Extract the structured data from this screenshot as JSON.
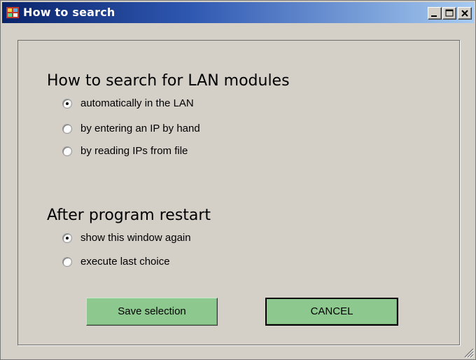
{
  "window": {
    "title": "How to search"
  },
  "search_section": {
    "heading": "How to search for LAN modules",
    "options": [
      {
        "label": "automatically in the LAN",
        "selected": true
      },
      {
        "label": "by entering an IP by hand",
        "selected": false
      },
      {
        "label": "by reading IPs from file",
        "selected": false
      }
    ]
  },
  "restart_section": {
    "heading": "After program restart",
    "options": [
      {
        "label": "show this window again",
        "selected": true
      },
      {
        "label": "execute last choice",
        "selected": false
      }
    ]
  },
  "buttons": {
    "save_label": "Save selection",
    "cancel_label": "CANCEL"
  },
  "colors": {
    "button_green": "#8dc98f",
    "titlebar_start": "#0a246a",
    "titlebar_end": "#a6caf0"
  }
}
